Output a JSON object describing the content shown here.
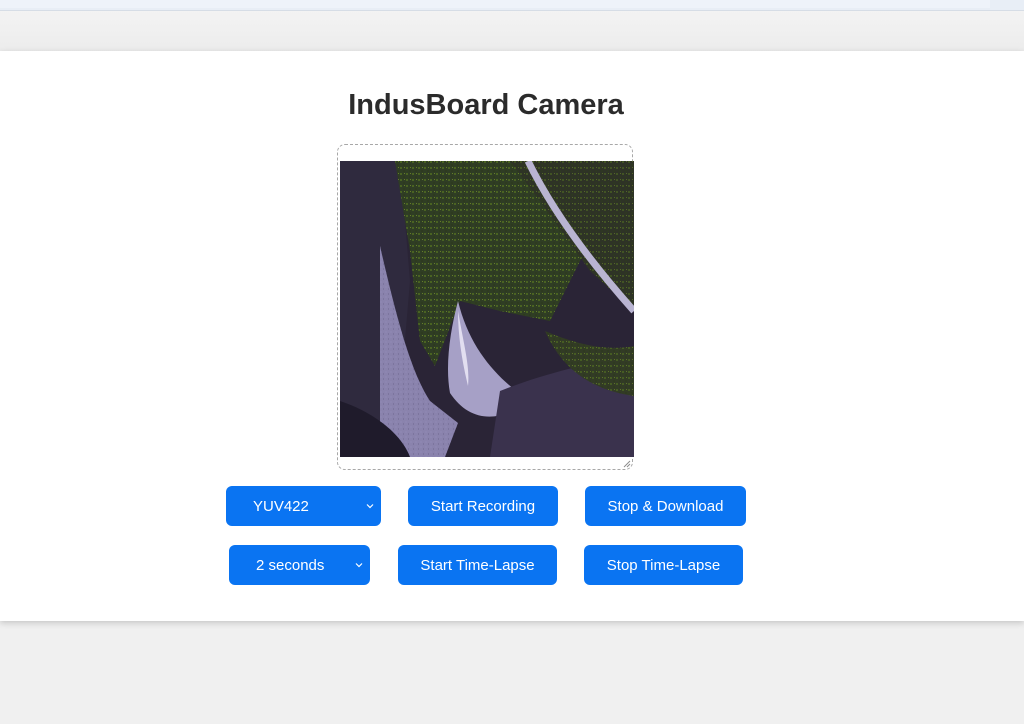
{
  "app": {
    "title": "IndusBoard Camera"
  },
  "controls": {
    "format_select": {
      "selected": "YUV422"
    },
    "start_recording_label": "Start Recording",
    "stop_download_label": "Stop & Download",
    "interval_select": {
      "selected": "2 seconds"
    },
    "start_timelapse_label": "Start Time-Lapse",
    "stop_timelapse_label": "Stop Time-Lapse"
  },
  "colors": {
    "button_bg": "#0a74f2",
    "button_text": "#ffffff",
    "title_text": "#2b2b2b"
  },
  "icons": {
    "select_arrow": "chevron-down-icon",
    "resize_handle": "resize-grip-icon"
  }
}
